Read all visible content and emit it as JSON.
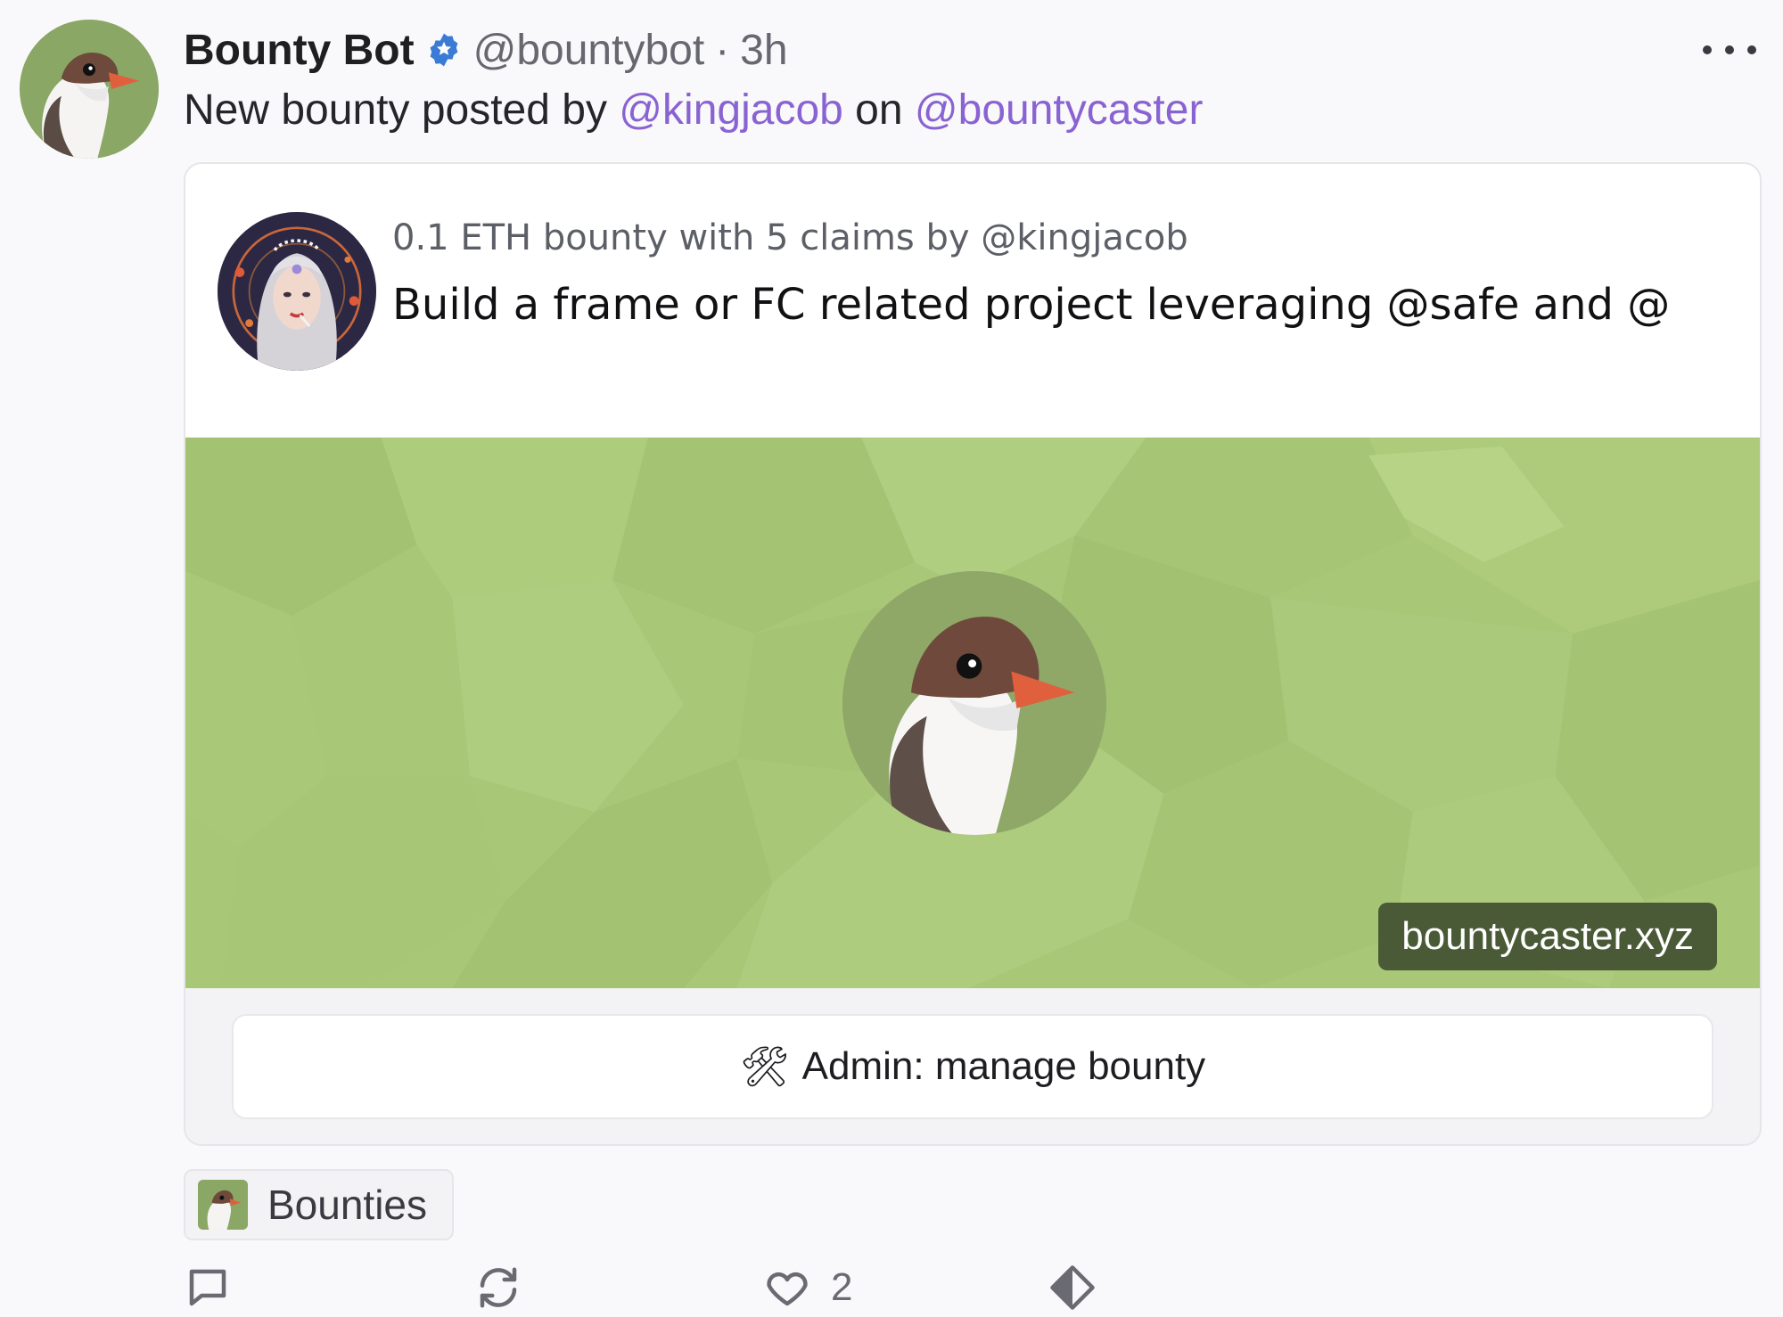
{
  "post": {
    "author": {
      "display_name": "Bounty Bot",
      "handle": "@bountybot",
      "separator": "·",
      "time": "3h",
      "verified_icon": "verified-badge-icon"
    },
    "body": {
      "prefix": "New bounty posted by ",
      "mention_1": "@kingjacob",
      "middle": " on ",
      "mention_2": "@bountycaster"
    },
    "more_icon": "more-horizontal-icon"
  },
  "embed": {
    "meta": "0.1 ETH bounty with 5 claims by @kingjacob",
    "title": "Build a frame or FC related project leveraging @safe and @",
    "domain": "bountycaster.xyz",
    "button": {
      "icon": "🛠",
      "label": "Admin: manage bounty"
    }
  },
  "channel": {
    "label": "Bounties"
  },
  "actions": {
    "reply_icon": "comment-icon",
    "recast_icon": "recast-icon",
    "like_icon": "heart-icon",
    "like_count": "2",
    "tip_icon": "diamond-icon"
  },
  "colors": {
    "mention": "#8a63d2",
    "frame_bg": "#a9c978",
    "badge_bg": "#4a5a36"
  }
}
